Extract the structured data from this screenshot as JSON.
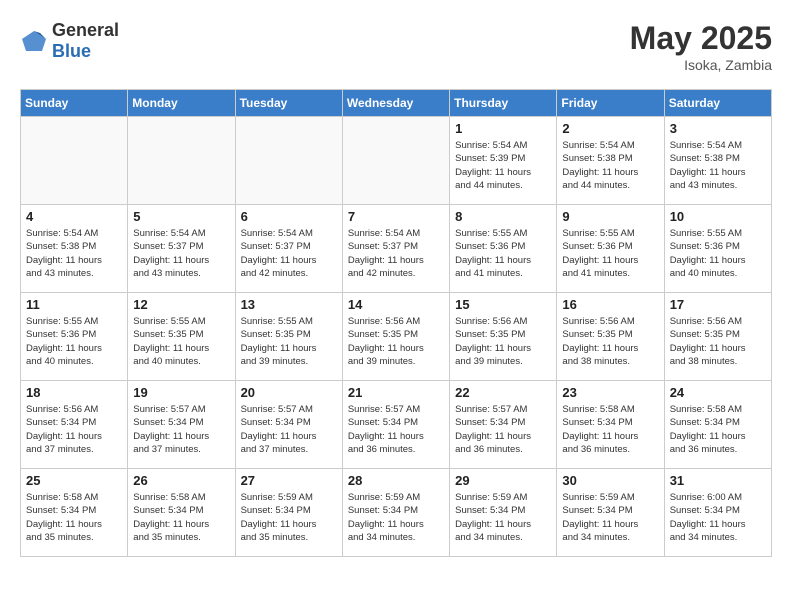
{
  "header": {
    "logo_general": "General",
    "logo_blue": "Blue",
    "month_year": "May 2025",
    "location": "Isoka, Zambia"
  },
  "weekdays": [
    "Sunday",
    "Monday",
    "Tuesday",
    "Wednesday",
    "Thursday",
    "Friday",
    "Saturday"
  ],
  "weeks": [
    [
      {
        "day": "",
        "info": ""
      },
      {
        "day": "",
        "info": ""
      },
      {
        "day": "",
        "info": ""
      },
      {
        "day": "",
        "info": ""
      },
      {
        "day": "1",
        "info": "Sunrise: 5:54 AM\nSunset: 5:39 PM\nDaylight: 11 hours\nand 44 minutes."
      },
      {
        "day": "2",
        "info": "Sunrise: 5:54 AM\nSunset: 5:38 PM\nDaylight: 11 hours\nand 44 minutes."
      },
      {
        "day": "3",
        "info": "Sunrise: 5:54 AM\nSunset: 5:38 PM\nDaylight: 11 hours\nand 43 minutes."
      }
    ],
    [
      {
        "day": "4",
        "info": "Sunrise: 5:54 AM\nSunset: 5:38 PM\nDaylight: 11 hours\nand 43 minutes."
      },
      {
        "day": "5",
        "info": "Sunrise: 5:54 AM\nSunset: 5:37 PM\nDaylight: 11 hours\nand 43 minutes."
      },
      {
        "day": "6",
        "info": "Sunrise: 5:54 AM\nSunset: 5:37 PM\nDaylight: 11 hours\nand 42 minutes."
      },
      {
        "day": "7",
        "info": "Sunrise: 5:54 AM\nSunset: 5:37 PM\nDaylight: 11 hours\nand 42 minutes."
      },
      {
        "day": "8",
        "info": "Sunrise: 5:55 AM\nSunset: 5:36 PM\nDaylight: 11 hours\nand 41 minutes."
      },
      {
        "day": "9",
        "info": "Sunrise: 5:55 AM\nSunset: 5:36 PM\nDaylight: 11 hours\nand 41 minutes."
      },
      {
        "day": "10",
        "info": "Sunrise: 5:55 AM\nSunset: 5:36 PM\nDaylight: 11 hours\nand 40 minutes."
      }
    ],
    [
      {
        "day": "11",
        "info": "Sunrise: 5:55 AM\nSunset: 5:36 PM\nDaylight: 11 hours\nand 40 minutes."
      },
      {
        "day": "12",
        "info": "Sunrise: 5:55 AM\nSunset: 5:35 PM\nDaylight: 11 hours\nand 40 minutes."
      },
      {
        "day": "13",
        "info": "Sunrise: 5:55 AM\nSunset: 5:35 PM\nDaylight: 11 hours\nand 39 minutes."
      },
      {
        "day": "14",
        "info": "Sunrise: 5:56 AM\nSunset: 5:35 PM\nDaylight: 11 hours\nand 39 minutes."
      },
      {
        "day": "15",
        "info": "Sunrise: 5:56 AM\nSunset: 5:35 PM\nDaylight: 11 hours\nand 39 minutes."
      },
      {
        "day": "16",
        "info": "Sunrise: 5:56 AM\nSunset: 5:35 PM\nDaylight: 11 hours\nand 38 minutes."
      },
      {
        "day": "17",
        "info": "Sunrise: 5:56 AM\nSunset: 5:35 PM\nDaylight: 11 hours\nand 38 minutes."
      }
    ],
    [
      {
        "day": "18",
        "info": "Sunrise: 5:56 AM\nSunset: 5:34 PM\nDaylight: 11 hours\nand 37 minutes."
      },
      {
        "day": "19",
        "info": "Sunrise: 5:57 AM\nSunset: 5:34 PM\nDaylight: 11 hours\nand 37 minutes."
      },
      {
        "day": "20",
        "info": "Sunrise: 5:57 AM\nSunset: 5:34 PM\nDaylight: 11 hours\nand 37 minutes."
      },
      {
        "day": "21",
        "info": "Sunrise: 5:57 AM\nSunset: 5:34 PM\nDaylight: 11 hours\nand 36 minutes."
      },
      {
        "day": "22",
        "info": "Sunrise: 5:57 AM\nSunset: 5:34 PM\nDaylight: 11 hours\nand 36 minutes."
      },
      {
        "day": "23",
        "info": "Sunrise: 5:58 AM\nSunset: 5:34 PM\nDaylight: 11 hours\nand 36 minutes."
      },
      {
        "day": "24",
        "info": "Sunrise: 5:58 AM\nSunset: 5:34 PM\nDaylight: 11 hours\nand 36 minutes."
      }
    ],
    [
      {
        "day": "25",
        "info": "Sunrise: 5:58 AM\nSunset: 5:34 PM\nDaylight: 11 hours\nand 35 minutes."
      },
      {
        "day": "26",
        "info": "Sunrise: 5:58 AM\nSunset: 5:34 PM\nDaylight: 11 hours\nand 35 minutes."
      },
      {
        "day": "27",
        "info": "Sunrise: 5:59 AM\nSunset: 5:34 PM\nDaylight: 11 hours\nand 35 minutes."
      },
      {
        "day": "28",
        "info": "Sunrise: 5:59 AM\nSunset: 5:34 PM\nDaylight: 11 hours\nand 34 minutes."
      },
      {
        "day": "29",
        "info": "Sunrise: 5:59 AM\nSunset: 5:34 PM\nDaylight: 11 hours\nand 34 minutes."
      },
      {
        "day": "30",
        "info": "Sunrise: 5:59 AM\nSunset: 5:34 PM\nDaylight: 11 hours\nand 34 minutes."
      },
      {
        "day": "31",
        "info": "Sunrise: 6:00 AM\nSunset: 5:34 PM\nDaylight: 11 hours\nand 34 minutes."
      }
    ]
  ]
}
